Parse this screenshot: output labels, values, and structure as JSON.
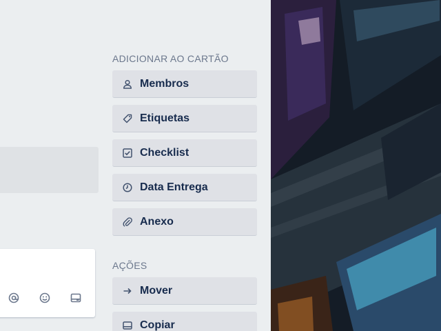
{
  "sidebar": {
    "add_section_title": "ADICIONAR AO CARTÃO",
    "add_items": [
      {
        "label": "Membros",
        "icon": "person-icon"
      },
      {
        "label": "Etiquetas",
        "icon": "tag-icon"
      },
      {
        "label": "Checklist",
        "icon": "checklist-icon"
      },
      {
        "label": "Data Entrega",
        "icon": "clock-icon"
      },
      {
        "label": "Anexo",
        "icon": "paperclip-icon"
      }
    ],
    "actions_section_title": "AÇÕES",
    "action_items": [
      {
        "label": "Mover",
        "icon": "arrow-right-icon"
      },
      {
        "label": "Copiar",
        "icon": "card-icon"
      }
    ]
  },
  "comment": {
    "icons": [
      "at-sign-icon",
      "emoji-icon",
      "card-icon"
    ]
  },
  "background": {
    "type": "city street aerial photo"
  },
  "colors": {
    "panel_bg": "#ebeef0",
    "button_bg": "#dfe1e6",
    "text_primary": "#172b4d",
    "text_muted": "#6b778c"
  }
}
